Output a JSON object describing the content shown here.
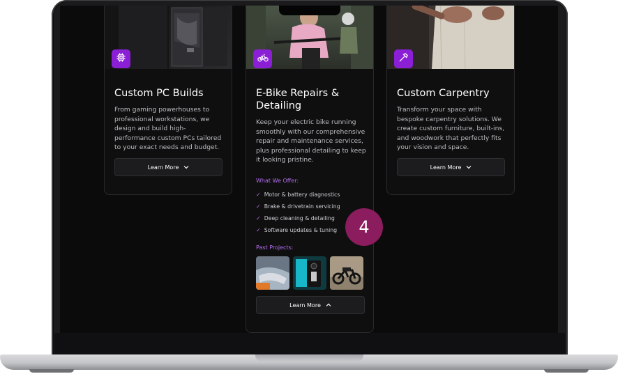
{
  "cards": [
    {
      "title": "Custom PC Builds",
      "description": "From gaming powerhouses to professional workstations, we design and build high-performance custom PCs tailored to your exact needs and budget.",
      "button_label": "Learn More",
      "icon": "chip-icon"
    },
    {
      "title_line1": "E-Bike Repairs &",
      "title_line2": "Detailing",
      "description": "Keep your electric bike running smoothly with our comprehensive repair and maintenance services, plus professional detailing to keep it looking pristine.",
      "offer_heading": "What We Offer:",
      "offers": [
        "Motor & battery diagnostics",
        "Brake & drivetrain servicing",
        "Deep cleaning & detailing",
        "Software updates & tuning"
      ],
      "projects_heading": "Past Projects:",
      "button_label": "Learn More",
      "icon": "bicycle-icon"
    },
    {
      "title": "Custom Carpentry",
      "description": "Transform your space with bespoke carpentry solutions. We create custom furniture, built-ins, and woodwork that perfectly fits your vision and space.",
      "button_label": "Learn More",
      "icon": "hammer-icon"
    }
  ],
  "step_marker": "4",
  "colors": {
    "accent": "#8a1fd6",
    "accent_text": "#b66df0",
    "marker": "#8b1c5e",
    "card_bg": "#0f0f10",
    "screen_bg": "#0b0b0b"
  }
}
